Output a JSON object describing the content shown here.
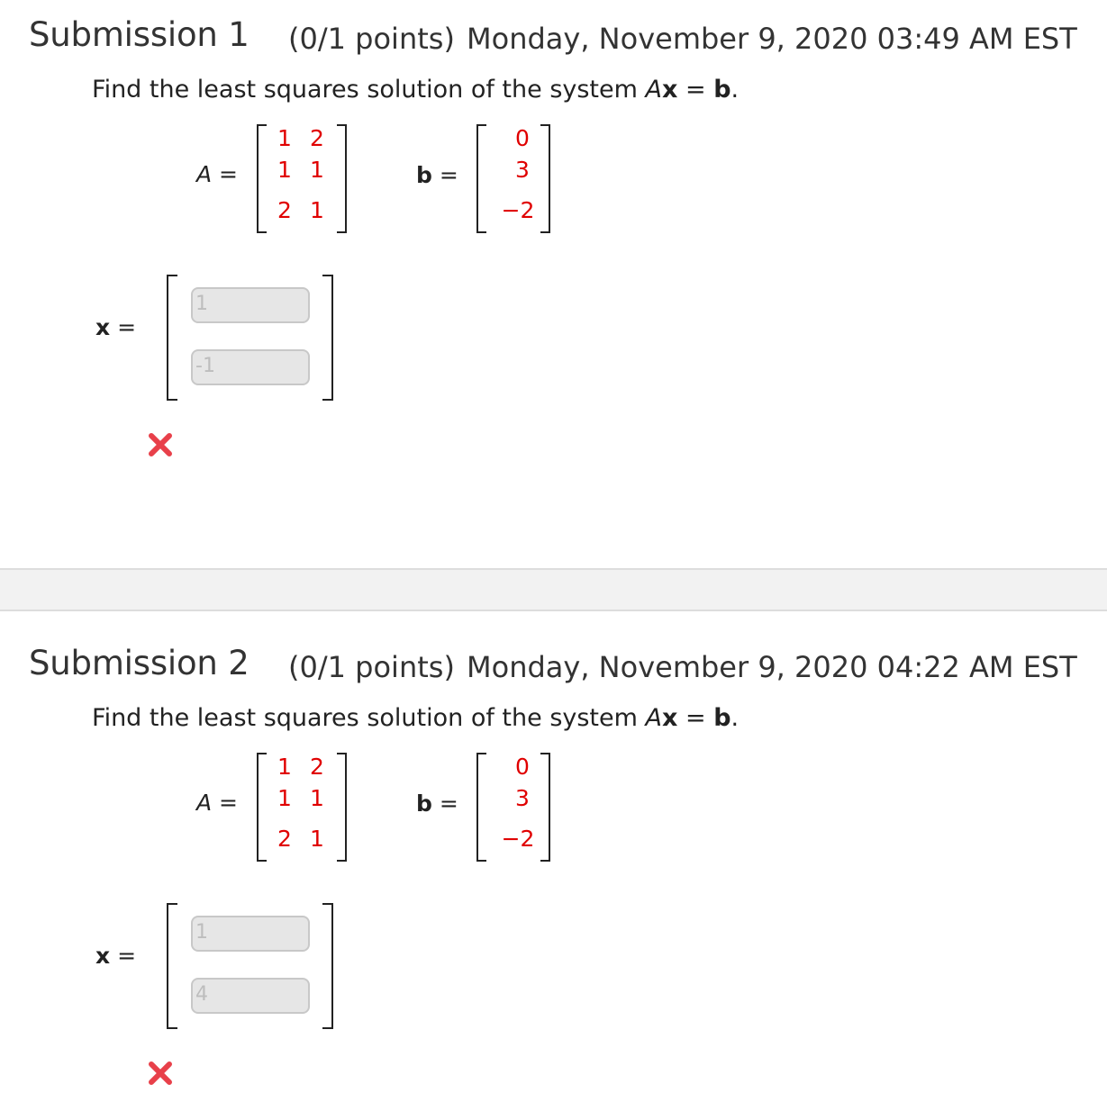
{
  "submissions": [
    {
      "title": "Submission 1",
      "points": "(0/1 points)",
      "timestamp": "Monday, November 9, 2020 03:49 AM EST",
      "question": {
        "prefix": "Find the least squares solution of the system ",
        "A": "A",
        "x": "x",
        "eq": " = ",
        "b": "b",
        "period": "."
      },
      "labels": {
        "A": "A",
        "A_eq": " =",
        "b": "b",
        "b_eq": " =",
        "x": "x",
        "x_eq": " ="
      },
      "matrix_A": [
        [
          "1",
          "2"
        ],
        [
          "1",
          "1"
        ],
        [
          "2",
          "1"
        ]
      ],
      "vector_b": [
        "0",
        "3",
        "−2"
      ],
      "answers": [
        "1",
        "-1"
      ],
      "result_icon": "incorrect-x-icon"
    },
    {
      "title": "Submission 2",
      "points": "(0/1 points)",
      "timestamp": "Monday, November 9, 2020 04:22 AM EST",
      "question": {
        "prefix": "Find the least squares solution of the system ",
        "A": "A",
        "x": "x",
        "eq": " = ",
        "b": "b",
        "period": "."
      },
      "labels": {
        "A": "A",
        "A_eq": " =",
        "b": "b",
        "b_eq": " =",
        "x": "x",
        "x_eq": " ="
      },
      "matrix_A": [
        [
          "1",
          "2"
        ],
        [
          "1",
          "1"
        ],
        [
          "2",
          "1"
        ]
      ],
      "vector_b": [
        "0",
        "3",
        "−2"
      ],
      "answers": [
        "1",
        "4"
      ],
      "result_icon": "incorrect-x-icon"
    }
  ],
  "colors": {
    "given_values": "#e00000",
    "incorrect_mark": "#e8404a",
    "answer_box_bg": "#e6e6e6"
  }
}
